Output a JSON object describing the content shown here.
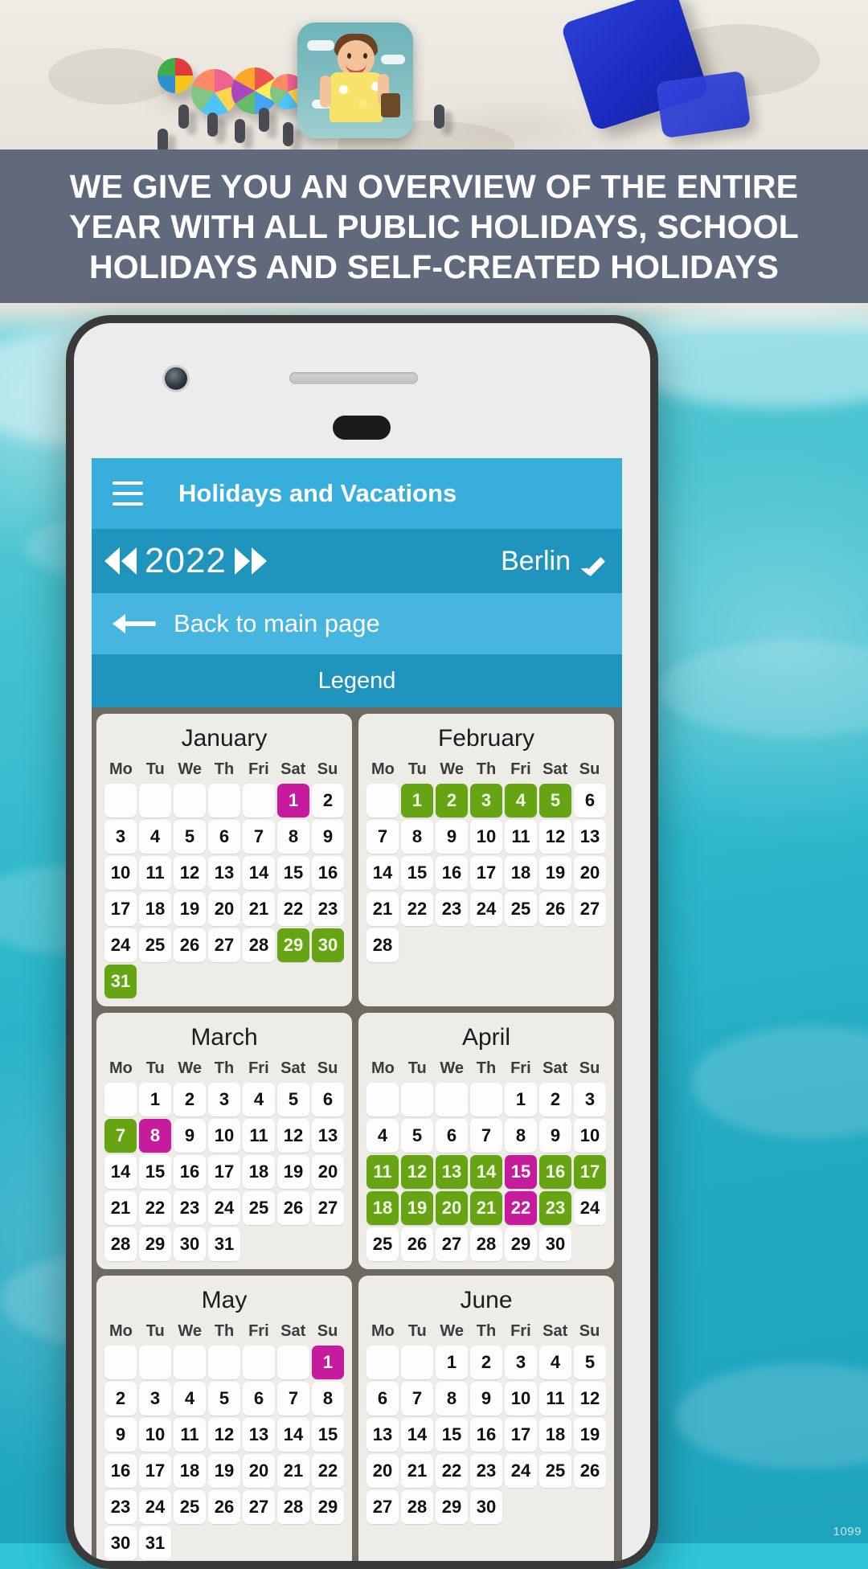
{
  "banner": {
    "headline": "We give you an overview of the entire year with all public holidays, school holidays and self-created holidays"
  },
  "app": {
    "menu_icon": "hamburger-icon",
    "title": "Holidays and Vacations",
    "year": "2022",
    "prev_icon": "double-chevron-left-icon",
    "next_icon": "double-chevron-right-icon",
    "region": "Berlin",
    "edit_icon": "pencil-icon",
    "back_icon": "arrow-left-icon",
    "back_label": "Back to main page",
    "legend_label": "Legend"
  },
  "colors": {
    "appbar": "#38AFDB",
    "yearbar": "#1F94BD",
    "backbar": "#46B6E0",
    "holiday": "#C71B9E",
    "school_holiday": "#67A413",
    "banner_bg": "#616A7D",
    "months_bg": "#6D6A63"
  },
  "weekdays": [
    "Mo",
    "Tu",
    "We",
    "Th",
    "Fri",
    "Sat",
    "Su"
  ],
  "calendar": {
    "year": 2022,
    "months": [
      {
        "name": "January",
        "lead_blanks": 5,
        "days": 31,
        "holidays": [
          1
        ],
        "school_holidays": [
          29,
          30,
          31
        ]
      },
      {
        "name": "February",
        "lead_blanks": 1,
        "days": 28,
        "holidays": [],
        "school_holidays": [
          1,
          2,
          3,
          4,
          5
        ]
      },
      {
        "name": "March",
        "lead_blanks": 1,
        "days": 31,
        "holidays": [
          8
        ],
        "school_holidays": [
          7
        ]
      },
      {
        "name": "April",
        "lead_blanks": 4,
        "days": 30,
        "holidays": [
          15,
          22
        ],
        "school_holidays": [
          11,
          12,
          13,
          14,
          16,
          17,
          18,
          19,
          20,
          21,
          23
        ]
      },
      {
        "name": "May",
        "lead_blanks": 6,
        "days": 31,
        "holidays": [
          1
        ],
        "school_holidays": []
      },
      {
        "name": "June",
        "lead_blanks": 2,
        "days": 30,
        "holidays": [],
        "school_holidays": []
      }
    ]
  },
  "watermark": "1099"
}
